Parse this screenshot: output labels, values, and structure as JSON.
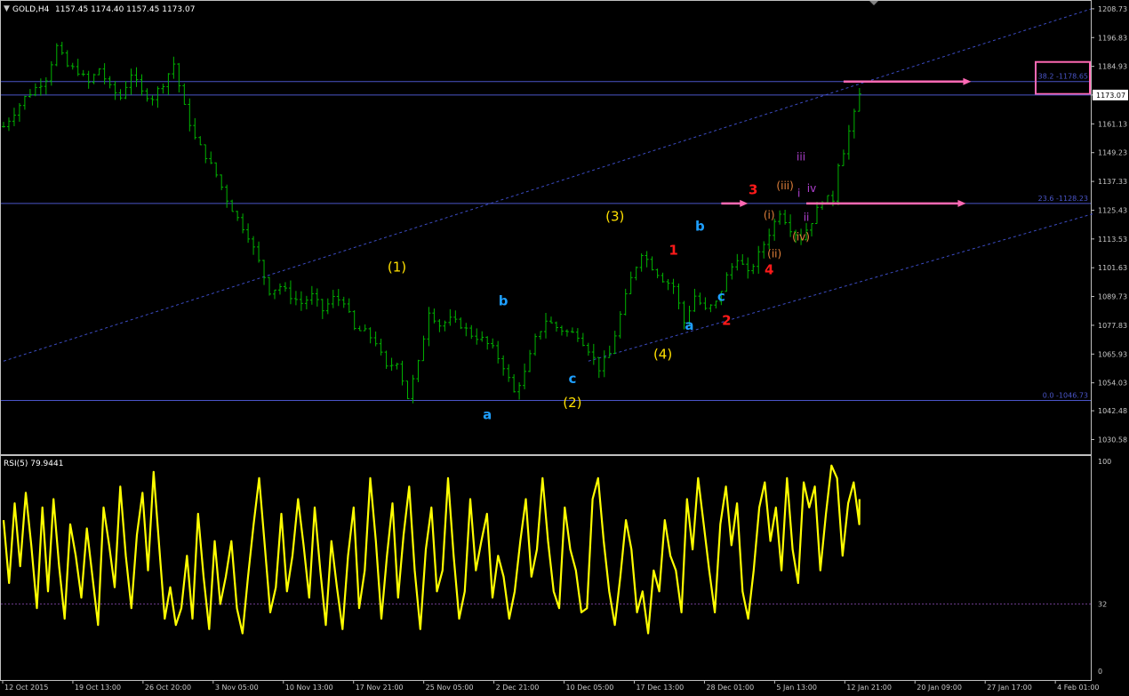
{
  "header": {
    "symbol": "GOLD,H4",
    "ohlc": "1157.45 1174.40 1157.45 1173.07"
  },
  "colors": {
    "background": "#000000",
    "frame": "#c0c0c0",
    "axis_text": "#c8c8c8",
    "price_bar": "#00b400",
    "rsi_line": "#ffff00",
    "level_line": "#4a55c8",
    "channel_line": "#3c4cc4",
    "arrow": "#ff69b4",
    "fib_box": "#ff69b4",
    "label_yellow": "#ffe000",
    "label_cyan": "#1e9fff",
    "label_red": "#ff1a1a",
    "label_orange": "#e0803a",
    "label_purple": "#b040d0"
  },
  "chart_data": [
    {
      "type": "candlestick",
      "title": "GOLD,H4",
      "price_ylim": [
        1024.5,
        1212.0
      ],
      "price_ticks": [
        "1208.73",
        "1196.83",
        "1184.93",
        "1173.07",
        "1161.13",
        "1149.23",
        "1137.33",
        "1125.43",
        "1113.53",
        "1101.63",
        "1089.73",
        "1077.83",
        "1065.93",
        "1054.03",
        "1042.48",
        "1030.58"
      ],
      "current_price": "1173.07",
      "x_labels": [
        "12 Oct 2015",
        "19 Oct 13:00",
        "26 Oct 20:00",
        "3 Nov 05:00",
        "10 Nov 13:00",
        "17 Nov 21:00",
        "25 Nov 05:00",
        "2 Dec 21:00",
        "10 Dec 05:00",
        "17 Dec 13:00",
        "28 Dec 01:00",
        "5 Jan 13:00",
        "12 Jan 21:00",
        "20 Jan 09:00",
        "27 Jan 17:00",
        "4 Feb 01:00"
      ],
      "close_path": [
        [
          0,
          1160
        ],
        [
          4,
          1172
        ],
        [
          8,
          1180
        ],
        [
          10,
          1193
        ],
        [
          12,
          1185
        ],
        [
          14,
          1183
        ],
        [
          16,
          1178
        ],
        [
          18,
          1184
        ],
        [
          20,
          1176
        ],
        [
          22,
          1172
        ],
        [
          24,
          1182
        ],
        [
          26,
          1174
        ],
        [
          28,
          1172
        ],
        [
          30,
          1178
        ],
        [
          32,
          1186
        ],
        [
          34,
          1168
        ],
        [
          36,
          1155
        ],
        [
          38,
          1148
        ],
        [
          40,
          1140
        ],
        [
          42,
          1130
        ],
        [
          44,
          1122
        ],
        [
          46,
          1115
        ],
        [
          48,
          1104
        ],
        [
          50,
          1092
        ],
        [
          52,
          1094
        ],
        [
          54,
          1090
        ],
        [
          56,
          1087
        ],
        [
          58,
          1090
        ],
        [
          60,
          1084
        ],
        [
          62,
          1089
        ],
        [
          64,
          1088
        ],
        [
          66,
          1076
        ],
        [
          68,
          1075
        ],
        [
          70,
          1071
        ],
        [
          72,
          1060
        ],
        [
          74,
          1063
        ],
        [
          76,
          1048
        ],
        [
          78,
          1062
        ],
        [
          80,
          1084
        ],
        [
          82,
          1078
        ],
        [
          84,
          1080
        ],
        [
          86,
          1078
        ],
        [
          88,
          1074
        ],
        [
          90,
          1072
        ],
        [
          92,
          1068
        ],
        [
          94,
          1061
        ],
        [
          96,
          1050
        ],
        [
          98,
          1058
        ],
        [
          100,
          1072
        ],
        [
          102,
          1080
        ],
        [
          104,
          1077
        ],
        [
          106,
          1075
        ],
        [
          108,
          1074
        ],
        [
          110,
          1068
        ],
        [
          112,
          1060
        ],
        [
          114,
          1066
        ],
        [
          116,
          1082
        ],
        [
          118,
          1097
        ],
        [
          120,
          1108
        ],
        [
          122,
          1102
        ],
        [
          124,
          1097
        ],
        [
          126,
          1094
        ],
        [
          128,
          1079
        ],
        [
          130,
          1090
        ],
        [
          132,
          1084
        ],
        [
          134,
          1087
        ],
        [
          136,
          1098
        ],
        [
          138,
          1106
        ],
        [
          140,
          1099
        ],
        [
          142,
          1107
        ],
        [
          144,
          1116
        ],
        [
          146,
          1125
        ],
        [
          148,
          1118
        ],
        [
          150,
          1114
        ],
        [
          152,
          1121
        ],
        [
          154,
          1130
        ],
        [
          156,
          1130
        ],
        [
          157,
          1145
        ],
        [
          158,
          1150
        ],
        [
          159,
          1158
        ],
        [
          160,
          1165
        ],
        [
          161,
          1173
        ]
      ],
      "fib_levels": [
        {
          "label": "38.2 -1178.65",
          "price": 1178.65,
          "boxed": true
        },
        {
          "label": "23.6 -1128.23",
          "price": 1128.23,
          "boxed": false
        },
        {
          "label": "0.0 -1046.73",
          "price": 1046.73,
          "boxed": false
        }
      ],
      "extra_levels": [
        1173.07
      ],
      "channel_lines": [
        {
          "from": [
            0,
            1063
          ],
          "to": [
            205,
            1209
          ]
        },
        {
          "from": [
            110,
            1063
          ],
          "to": [
            205,
            1124
          ]
        }
      ],
      "arrows": [
        {
          "from": [
            158,
            1178.65
          ],
          "to": [
            182,
            1178.65
          ]
        },
        {
          "from": [
            135,
            1128.23
          ],
          "to": [
            140,
            1128.23
          ]
        },
        {
          "from": [
            151,
            1128.23
          ],
          "to": [
            181,
            1128.23
          ]
        }
      ],
      "wave_labels": [
        {
          "text": "(1)",
          "x": 74,
          "price": 1100,
          "color": "yellow"
        },
        {
          "text": "(2)",
          "x": 107,
          "price": 1044,
          "color": "yellow"
        },
        {
          "text": "(3)",
          "x": 115,
          "price": 1121,
          "color": "yellow"
        },
        {
          "text": "(4)",
          "x": 124,
          "price": 1064,
          "color": "yellow"
        },
        {
          "text": "b",
          "x": 94,
          "price": 1086,
          "color": "cyan"
        },
        {
          "text": "a",
          "x": 91,
          "price": 1039,
          "color": "cyan"
        },
        {
          "text": "c",
          "x": 107,
          "price": 1054,
          "color": "cyan"
        },
        {
          "text": "b",
          "x": 131,
          "price": 1117,
          "color": "cyan"
        },
        {
          "text": "c",
          "x": 135,
          "price": 1088,
          "color": "cyan"
        },
        {
          "text": "a",
          "x": 129,
          "price": 1076,
          "color": "cyan"
        },
        {
          "text": "1",
          "x": 126,
          "price": 1107,
          "color": "red"
        },
        {
          "text": "2",
          "x": 136,
          "price": 1078,
          "color": "red"
        },
        {
          "text": "3",
          "x": 141,
          "price": 1132,
          "color": "red"
        },
        {
          "text": "4",
          "x": 144,
          "price": 1099,
          "color": "red"
        },
        {
          "text": "(i)",
          "x": 144,
          "price": 1122,
          "color": "orange"
        },
        {
          "text": "(ii)",
          "x": 145,
          "price": 1106,
          "color": "orange"
        },
        {
          "text": "(iii)",
          "x": 147,
          "price": 1134,
          "color": "orange"
        },
        {
          "text": "(iv)",
          "x": 150,
          "price": 1113,
          "color": "orange"
        },
        {
          "text": "iii",
          "x": 150,
          "price": 1146,
          "color": "purple"
        },
        {
          "text": "i",
          "x": 149.6,
          "price": 1131,
          "color": "purple"
        },
        {
          "text": "iv",
          "x": 152,
          "price": 1133,
          "color": "purple"
        },
        {
          "text": "ii",
          "x": 151,
          "price": 1121,
          "color": "purple"
        }
      ]
    },
    {
      "type": "line",
      "title": "RSI(5) 79.9441",
      "ylim": [
        0,
        100
      ],
      "ticks": [
        "100",
        "32",
        "0"
      ],
      "level": 32,
      "series": [
        {
          "name": "RSI(5)",
          "values": [
            72,
            42,
            80,
            50,
            85,
            60,
            30,
            78,
            38,
            82,
            50,
            25,
            70,
            55,
            35,
            68,
            45,
            22,
            78,
            60,
            40,
            88,
            55,
            30,
            65,
            85,
            48,
            95,
            60,
            25,
            40,
            22,
            30,
            55,
            25,
            75,
            45,
            20,
            62,
            32,
            45,
            62,
            30,
            18,
            45,
            70,
            92,
            60,
            28,
            40,
            75,
            38,
            55,
            82,
            60,
            35,
            78,
            48,
            22,
            62,
            40,
            20,
            55,
            78,
            30,
            48,
            92,
            62,
            25,
            55,
            80,
            35,
            65,
            88,
            48,
            20,
            58,
            78,
            38,
            48,
            92,
            55,
            25,
            38,
            82,
            48,
            62,
            75,
            35,
            55,
            45,
            25,
            38,
            62,
            82,
            45,
            58,
            92,
            62,
            38,
            30,
            78,
            58,
            48,
            28,
            30,
            82,
            92,
            62,
            38,
            22,
            45,
            72,
            58,
            28,
            38,
            18,
            48,
            38,
            72,
            55,
            48,
            28,
            82,
            58,
            92,
            70,
            48,
            28,
            70,
            88,
            60,
            80,
            38,
            25,
            48,
            78,
            90,
            62,
            78,
            48,
            92,
            58,
            42,
            90,
            78,
            88,
            48,
            75,
            98,
            92,
            55,
            80,
            90,
            70,
            82
          ]
        }
      ]
    }
  ]
}
